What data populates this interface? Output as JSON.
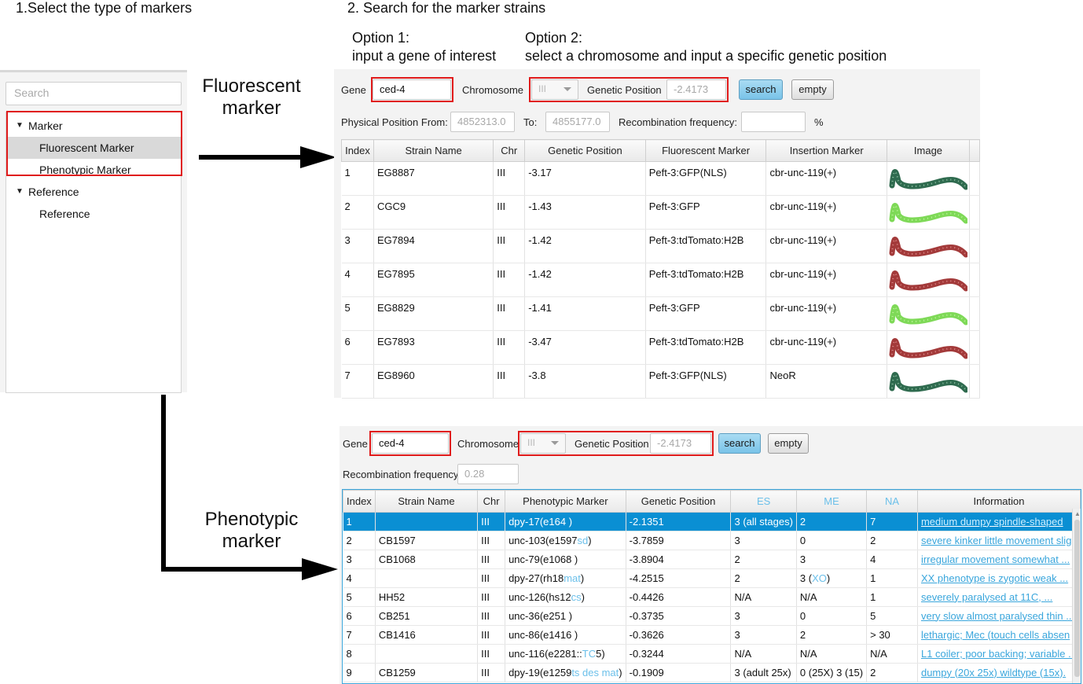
{
  "steps": {
    "step1": "1.Select the type of markers",
    "step2": "2. Search for the marker strains",
    "option1_title": "Option 1:",
    "option1_desc": "input a gene of interest",
    "option2_title": "Option 2:",
    "option2_desc": "select a chromosome and input a specific genetic position"
  },
  "labels": {
    "fluorescent_1": "Fluorescent",
    "fluorescent_2": "marker",
    "phenotypic_1": "Phenotypic",
    "phenotypic_2": "marker"
  },
  "tree": {
    "search_placeholder": "Search",
    "marker_label": "Marker",
    "fluorescent_item": "Fluorescent Marker",
    "phenotypic_item": "Phenotypic Marker",
    "reference_label": "Reference",
    "reference_item": "Reference"
  },
  "fluorescent_panel": {
    "gene_label": "Gene",
    "gene_value": "ced-4",
    "chromosome_label": "Chromosome",
    "chromosome_value": "III",
    "genetic_position_label": "Genetic Position",
    "genetic_position_value": "-2.4173",
    "search_button": "search",
    "empty_button": "empty",
    "physical_from_label": "Physical Position From:",
    "physical_from_value": "4852313.0",
    "to_label": "To:",
    "to_value": "4855177.0",
    "recomb_label": "Recombination frequency:",
    "recomb_value": "",
    "percent": "%",
    "columns": [
      "Index",
      "Strain Name",
      "Chr",
      "Genetic Position",
      "Fluorescent Marker",
      "Insertion Marker",
      "Image"
    ],
    "rows": [
      {
        "index": "1",
        "strain": "EG8887",
        "chr": "III",
        "pos": "-3.17",
        "fluor": "Peft-3:GFP(NLS)",
        "insertion": "cbr-unc-119(+)",
        "worm": "gfp-nls"
      },
      {
        "index": "2",
        "strain": "CGC9",
        "chr": "III",
        "pos": "-1.43",
        "fluor": "Peft-3:GFP",
        "insertion": "cbr-unc-119(+)",
        "worm": "gfp"
      },
      {
        "index": "3",
        "strain": "EG7894",
        "chr": "III",
        "pos": "-1.42",
        "fluor": "Peft-3:tdTomato:H2B",
        "insertion": "cbr-unc-119(+)",
        "worm": "tdtomato"
      },
      {
        "index": "4",
        "strain": "EG7895",
        "chr": "III",
        "pos": "-1.42",
        "fluor": "Peft-3:tdTomato:H2B",
        "insertion": "cbr-unc-119(+)",
        "worm": "tdtomato"
      },
      {
        "index": "5",
        "strain": "EG8829",
        "chr": "III",
        "pos": "-1.41",
        "fluor": "Peft-3:GFP",
        "insertion": "cbr-unc-119(+)",
        "worm": "gfp"
      },
      {
        "index": "6",
        "strain": "EG7893",
        "chr": "III",
        "pos": "-3.47",
        "fluor": "Peft-3:tdTomato:H2B",
        "insertion": "cbr-unc-119(+)",
        "worm": "tdtomato"
      },
      {
        "index": "7",
        "strain": "EG8960",
        "chr": "III",
        "pos": "-3.8",
        "fluor": "Peft-3:GFP(NLS)",
        "insertion": "NeoR",
        "worm": "gfp-nls"
      }
    ]
  },
  "phenotypic_panel": {
    "gene_label": "Gene",
    "gene_value": "ced-4",
    "chromosome_label": "Chromosome",
    "chromosome_value": "III",
    "genetic_position_label": "Genetic Position",
    "genetic_position_value": "-2.4173",
    "search_button": "search",
    "empty_button": "empty",
    "recomb_label": "Recombination frequency:",
    "recomb_value": "0.28",
    "columns": [
      "Index",
      "Strain Name",
      "Chr",
      "Phenotypic Marker",
      "Genetic Position",
      "ES",
      "ME",
      "NA",
      "Information"
    ],
    "rows": [
      {
        "index": "1",
        "strain": "",
        "chr": "III",
        "marker": "dpy-17(e164 )",
        "marker_suffix": "",
        "marker_tail": "",
        "pos": "-2.1351",
        "es": "3 (all stages)",
        "me": "2",
        "me_suffix": "",
        "me_tail": "",
        "na": "7",
        "info": "medium dumpy spindle-shaped",
        "selected": true
      },
      {
        "index": "2",
        "strain": "CB1597",
        "chr": "III",
        "marker": "unc-103(e1597",
        "marker_suffix": "sd",
        "marker_tail": ")",
        "pos": "-3.7859",
        "es": "3",
        "me": "0",
        "me_suffix": "",
        "me_tail": "",
        "na": "2",
        "info": "severe kinker little movement slig",
        "selected": false
      },
      {
        "index": "3",
        "strain": "CB1068",
        "chr": "III",
        "marker": "unc-79(e1068 )",
        "marker_suffix": "",
        "marker_tail": "",
        "pos": "-3.8904",
        "es": "2",
        "me": "3",
        "me_suffix": "",
        "me_tail": "",
        "na": "4",
        "info": "irregular movement somewhat ...",
        "selected": false
      },
      {
        "index": "4",
        "strain": "",
        "chr": "III",
        "marker": "dpy-27(rh18",
        "marker_suffix": "mat",
        "marker_tail": ")",
        "pos": "-4.2515",
        "es": "2",
        "me": "3 (",
        "me_suffix": "XO",
        "me_tail": ")",
        "na": "1",
        "info": "XX phenotype is zygotic weak ...",
        "selected": false
      },
      {
        "index": "5",
        "strain": "HH52",
        "chr": "III",
        "marker": "unc-126(hs12",
        "marker_suffix": "cs",
        "marker_tail": ")",
        "pos": "-0.4426",
        "es": "N/A",
        "me": "N/A",
        "me_suffix": "",
        "me_tail": "",
        "na": "1",
        "info": "severely paralysed at 11C, ...",
        "selected": false
      },
      {
        "index": "6",
        "strain": "CB251",
        "chr": "III",
        "marker": "unc-36(e251 )",
        "marker_suffix": "",
        "marker_tail": "",
        "pos": "-0.3735",
        "es": "3",
        "me": "0",
        "me_suffix": "",
        "me_tail": "",
        "na": "5",
        "info": "very slow almost paralysed thin ...",
        "selected": false
      },
      {
        "index": "7",
        "strain": "CB1416",
        "chr": "III",
        "marker": "unc-86(e1416 )",
        "marker_suffix": "",
        "marker_tail": "",
        "pos": "-0.3626",
        "es": "3",
        "me": "2",
        "me_suffix": "",
        "me_tail": "",
        "na": "> 30",
        "info": "lethargic; Mec (touch cells absen",
        "selected": false
      },
      {
        "index": "8",
        "strain": "",
        "chr": "III",
        "marker": "unc-116(e2281::",
        "marker_suffix": "TC",
        "marker_tail": "5)",
        "pos": "-0.3244",
        "es": "N/A",
        "me": "N/A",
        "me_suffix": "",
        "me_tail": "",
        "na": "N/A",
        "info": "L1 coiler; poor backing; variable ...",
        "selected": false
      },
      {
        "index": "9",
        "strain": "CB1259",
        "chr": "III",
        "marker": "dpy-19(e1259",
        "marker_suffix": "ts des mat",
        "marker_tail": ")",
        "pos": "-0.1909",
        "es": "3 (adult 25x)",
        "me": "0 (25X) 3 (15)",
        "me_suffix": "",
        "me_tail": "",
        "na": "2",
        "info": "dumpy (20x 25x) wildtype (15x).",
        "selected": false
      }
    ]
  },
  "colors": {
    "highlight_red": "#e01b1b",
    "selection_blue": "#0a8fd3",
    "link_blue": "#3aa6dc",
    "gfp_green": "#7ed957",
    "tdtomato_red": "#a33a3a",
    "nls_dark_green": "#2f6b4f"
  }
}
